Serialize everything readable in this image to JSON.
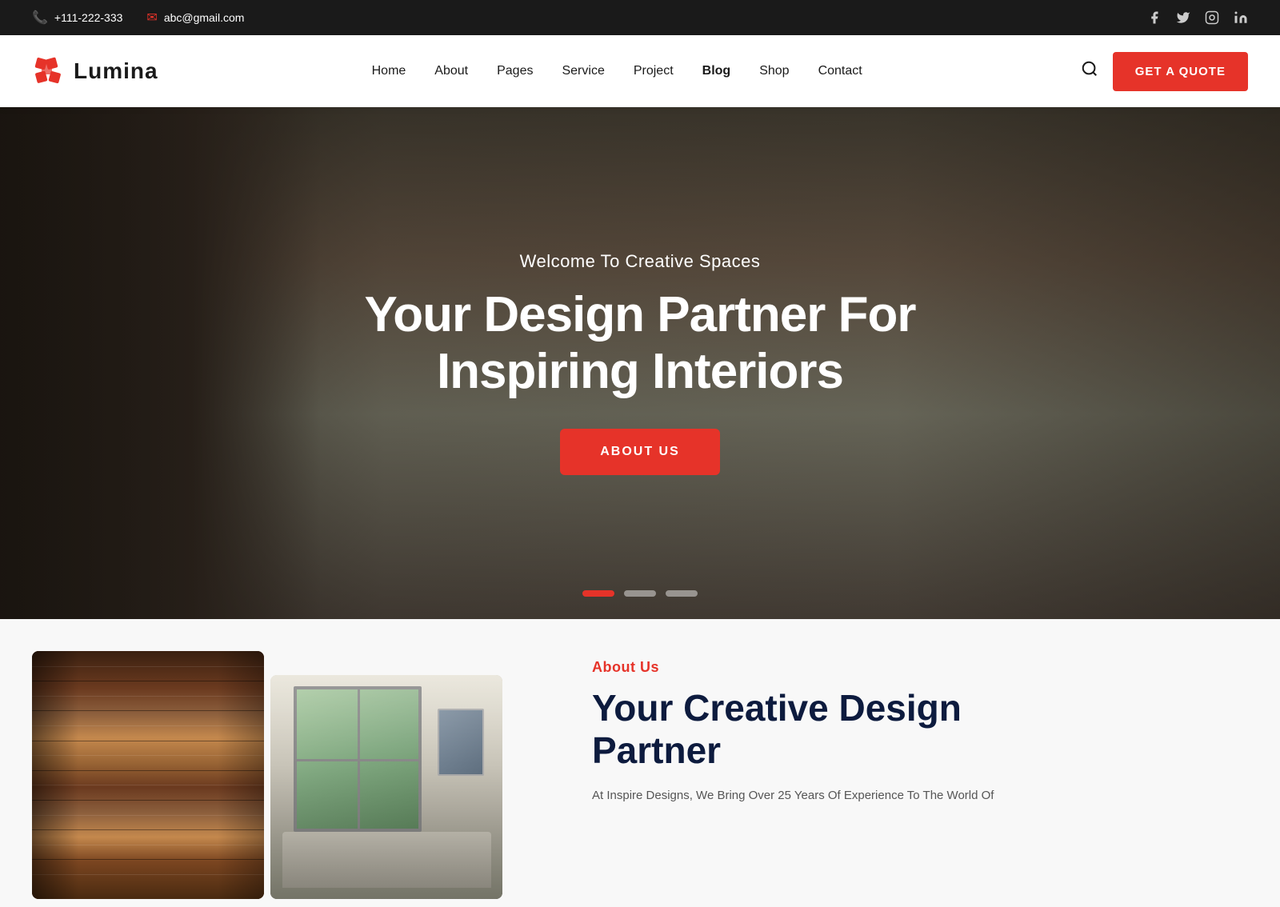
{
  "topbar": {
    "phone": "+111-222-333",
    "email": "abc@gmail.com",
    "phone_icon": "📞",
    "email_icon": "✉",
    "socials": [
      {
        "name": "facebook",
        "icon": "f",
        "label": "Facebook"
      },
      {
        "name": "twitter",
        "icon": "𝕏",
        "label": "Twitter"
      },
      {
        "name": "instagram",
        "icon": "◻",
        "label": "Instagram"
      },
      {
        "name": "linkedin",
        "icon": "in",
        "label": "LinkedIn"
      }
    ]
  },
  "header": {
    "logo_text": "Lumina",
    "nav_items": [
      {
        "label": "Home",
        "href": "#"
      },
      {
        "label": "About",
        "href": "#"
      },
      {
        "label": "Pages",
        "href": "#"
      },
      {
        "label": "Service",
        "href": "#"
      },
      {
        "label": "Project",
        "href": "#"
      },
      {
        "label": "Blog",
        "href": "#"
      },
      {
        "label": "Shop",
        "href": "#"
      },
      {
        "label": "Contact",
        "href": "#"
      }
    ],
    "get_quote_label": "GET A QUOTE"
  },
  "hero": {
    "subtitle": "Welcome To Creative Spaces",
    "title_line1": "Your Design Partner For",
    "title_line2": "Inspiring Interiors",
    "cta_label": "ABOUT US",
    "dots": [
      {
        "state": "active"
      },
      {
        "state": "inactive"
      },
      {
        "state": "inactive"
      }
    ]
  },
  "about_section": {
    "label": "About Us",
    "title_line1": "Your Creative Design",
    "title_line2": "Partner",
    "description": "At Inspire Designs, We Bring Over 25 Years Of Experience To The World Of"
  }
}
